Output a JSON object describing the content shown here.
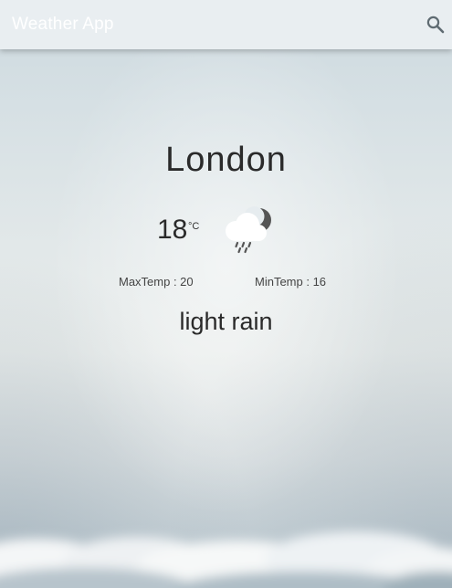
{
  "app": {
    "title": "Weather App"
  },
  "toolbar": {
    "search_icon": "search-icon"
  },
  "weather": {
    "city": "London",
    "temperature": "18",
    "unit": "°C",
    "max_temp_text": "MaxTemp : 20",
    "min_temp_text": "MinTemp : 16",
    "description": "light rain",
    "icon": "cloud-rain-night-icon"
  },
  "colors": {
    "toolbar_bg": "#e9eef1",
    "title_text": "#ffffff",
    "primary_text": "#2a2a2a",
    "secondary_text": "#444444",
    "icon_gray": "#555555"
  }
}
